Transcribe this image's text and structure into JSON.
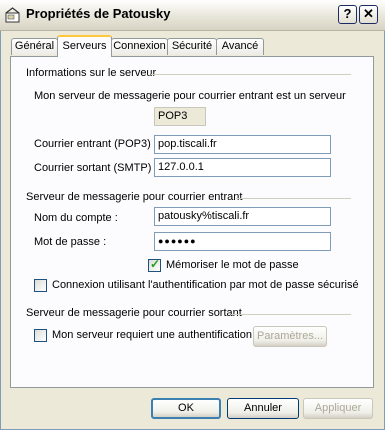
{
  "window": {
    "title": "Propriétés de Patousky",
    "help_button": "?",
    "close_button": "✕"
  },
  "tabs": [
    {
      "label": "Général",
      "active": false
    },
    {
      "label": "Serveurs",
      "active": true
    },
    {
      "label": "Connexion",
      "active": false
    },
    {
      "label": "Sécurité",
      "active": false
    },
    {
      "label": "Avancé",
      "active": false
    }
  ],
  "server_info": {
    "section_title": "Informations sur le serveur",
    "incoming_type_label": "Mon serveur de messagerie pour courrier entrant est un serveur",
    "incoming_type_value": "POP3",
    "incoming_label": "Courrier entrant (POP3) :",
    "incoming_value": "pop.tiscali.fr",
    "outgoing_label": "Courrier sortant (SMTP) :",
    "outgoing_value": "127.0.0.1"
  },
  "incoming_server": {
    "section_title": "Serveur de messagerie pour courrier entrant",
    "account_label": "Nom du compte :",
    "account_value": "patousky%tiscali.fr",
    "password_label": "Mot de passe :",
    "password_value": "●●●●●●",
    "remember_password_label": "Mémoriser le mot de passe",
    "remember_password_checked": true,
    "spa_label": "Connexion utilisant l'authentification par mot de passe sécurisé",
    "spa_checked": false
  },
  "outgoing_server": {
    "section_title": "Serveur de messagerie pour courrier sortant",
    "auth_required_label": "Mon serveur requiert une authentification",
    "auth_required_checked": false,
    "settings_button": "Paramètres..."
  },
  "footer": {
    "ok_button": "OK",
    "cancel_button": "Annuler",
    "apply_button": "Appliquer"
  }
}
